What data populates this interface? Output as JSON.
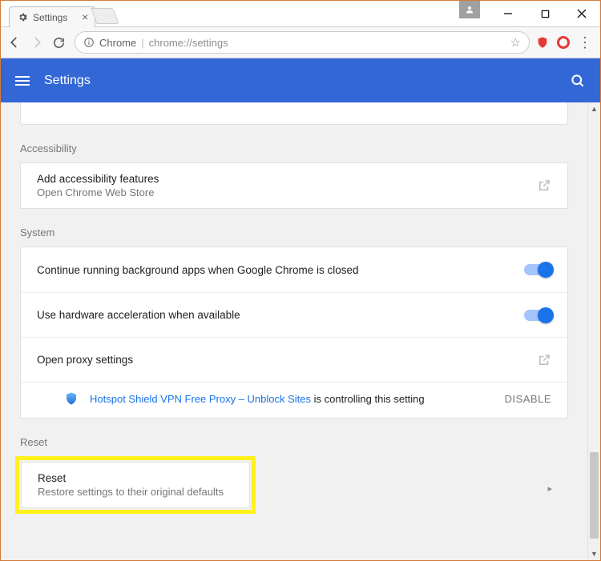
{
  "window": {
    "tab_title": "Settings"
  },
  "toolbar": {
    "chrome_label": "Chrome",
    "url": "chrome://settings"
  },
  "appbar": {
    "title": "Settings"
  },
  "sections": {
    "accessibility": {
      "label": "Accessibility",
      "item_title": "Add accessibility features",
      "item_sub": "Open Chrome Web Store"
    },
    "system": {
      "label": "System",
      "bg_apps": "Continue running background apps when Google Chrome is closed",
      "hw_accel": "Use hardware acceleration when available",
      "proxy": "Open proxy settings",
      "ext_name": "Hotspot Shield VPN Free Proxy – Unblock Sites",
      "ext_msg_suffix": " is controlling this setting",
      "disable_label": "DISABLE"
    },
    "reset": {
      "label": "Reset",
      "item_title": "Reset",
      "item_sub": "Restore settings to their original defaults"
    }
  }
}
